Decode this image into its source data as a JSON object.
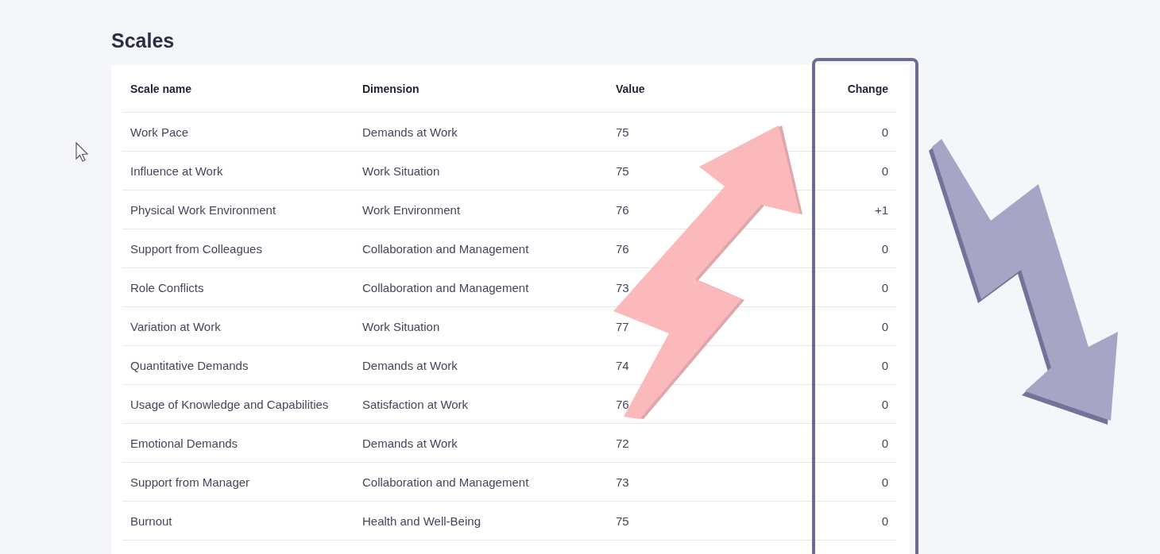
{
  "title": "Scales",
  "table": {
    "columns": [
      {
        "label": "Scale name",
        "highlighted": false
      },
      {
        "label": "Dimension",
        "highlighted": false
      },
      {
        "label": "Value",
        "highlighted": false
      },
      {
        "label": "Change",
        "highlighted": true
      }
    ],
    "rows": [
      [
        "Work Pace",
        "Demands at Work",
        "75",
        "0"
      ],
      [
        "Influence at Work",
        "Work Situation",
        "75",
        "0"
      ],
      [
        "Physical Work Environment",
        "Work Environment",
        "76",
        "+1"
      ],
      [
        "Support from Colleagues",
        "Collaboration and Management",
        "76",
        "0"
      ],
      [
        "Role Conflicts",
        "Collaboration and Management",
        "73",
        "0"
      ],
      [
        "Variation at Work",
        "Work Situation",
        "77",
        "0"
      ],
      [
        "Quantitative Demands",
        "Demands at Work",
        "74",
        "0"
      ],
      [
        "Usage of Knowledge and Capabilities",
        "Satisfaction at Work",
        "76",
        "0"
      ],
      [
        "Emotional Demands",
        "Demands at Work",
        "72",
        "0"
      ],
      [
        "Support from Manager",
        "Collaboration and Management",
        "73",
        "0"
      ],
      [
        "Burnout",
        "Health and Well-Being",
        "75",
        "0"
      ]
    ]
  }
}
